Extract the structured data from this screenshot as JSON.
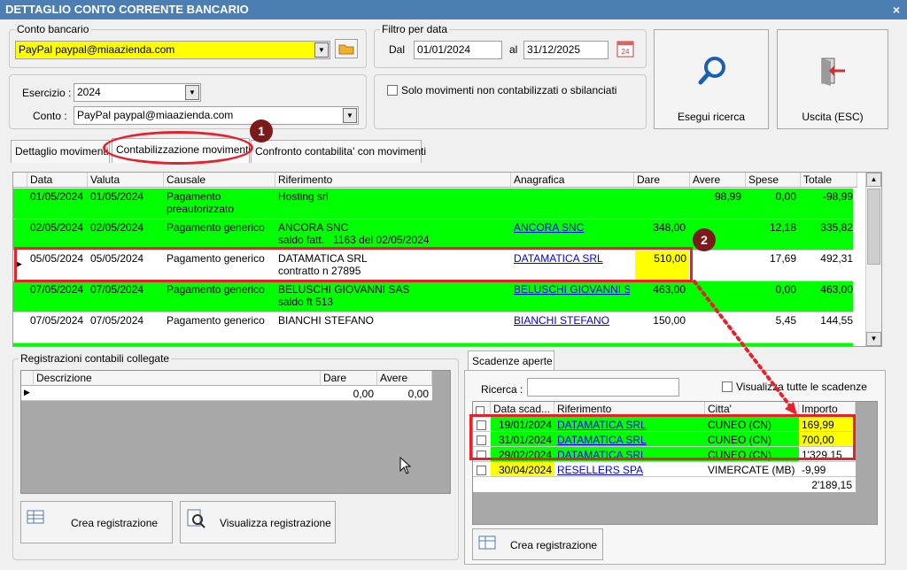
{
  "window": {
    "title": "DETTAGLIO CONTO CORRENTE BANCARIO",
    "close_glyph": "×"
  },
  "conto_bancario": {
    "label": "Conto bancario",
    "value": "PayPal paypal@miaazienda.com"
  },
  "filtro": {
    "label": "Filtro per data",
    "dal_label": "Dal",
    "dal_value": "01/01/2024",
    "al_label": "al",
    "al_value": "31/12/2025",
    "calendar_text": "24"
  },
  "esercizio": {
    "label": "Esercizio :",
    "value": "2024"
  },
  "conto": {
    "label": "Conto :",
    "value": "PayPal paypal@miaazienda.com"
  },
  "solo_movimenti": {
    "label": "Solo movimenti non contabilizzati o sbilanciati"
  },
  "buttons": {
    "esegui": "Esegui ricerca",
    "uscita": "Uscita (ESC)"
  },
  "tabs": [
    {
      "label": "Dettaglio movimenti"
    },
    {
      "label": "Contabilizzazione movimenti"
    },
    {
      "label": "Confronto contabilita' con movimenti"
    }
  ],
  "badges": {
    "one": "1",
    "two": "2"
  },
  "main_grid": {
    "headers": [
      "Data",
      "Valuta",
      "Causale",
      "Riferimento",
      "Anagrafica",
      "Dare",
      "Avere",
      "Spese",
      "Totale"
    ],
    "rows": [
      {
        "data": "01/05/2024",
        "valuta": "01/05/2024",
        "causale": "Pagamento\npreautorizzato",
        "riferimento": "Hosting srl",
        "anagrafica": "",
        "dare": "",
        "avere": "98,99",
        "spese": "0,00",
        "totale": "-98,99",
        "color": "green"
      },
      {
        "data": "02/05/2024",
        "valuta": "02/05/2024",
        "causale": "Pagamento generico",
        "riferimento": "ANCORA SNC\nsaldo fatt.   1163 del 02/05/2024",
        "anagrafica": "ANCORA SNC",
        "dare": "348,00",
        "avere": "",
        "spese": "12,18",
        "totale": "335,82",
        "color": "green"
      },
      {
        "data": "05/05/2024",
        "valuta": "05/05/2024",
        "causale": "Pagamento generico",
        "riferimento": "DATAMATICA SRL\ncontratto n 27895",
        "anagrafica": "DATAMATICA SRL",
        "dare": "510,00",
        "avere": "",
        "spese": "17,69",
        "totale": "492,31",
        "color": "white"
      },
      {
        "data": "07/05/2024",
        "valuta": "07/05/2024",
        "causale": "Pagamento generico",
        "riferimento": "BELUSCHI GIOVANNI SAS\nsaldo ft 513",
        "anagrafica": "BELUSCHI GIOVANNI SAS",
        "dare": "463,00",
        "avere": "",
        "spese": "0,00",
        "totale": "463,00",
        "color": "green"
      },
      {
        "data": "07/05/2024",
        "valuta": "07/05/2024",
        "causale": "Pagamento generico",
        "riferimento": "BIANCHI STEFANO",
        "anagrafica": "BIANCHI STEFANO",
        "dare": "150,00",
        "avere": "",
        "spese": "5,45",
        "totale": "144,55",
        "color": "white"
      }
    ]
  },
  "registrazioni": {
    "label": "Registrazioni contabili collegate",
    "headers": [
      "Descrizione",
      "Dare",
      "Avere"
    ],
    "row": {
      "dare": "0,00",
      "avere": "0,00"
    },
    "crea": "Crea registrazione",
    "visualizza": "Visualizza registrazione"
  },
  "scadenze": {
    "tab": "Scadenze aperte",
    "ricerca_label": "Ricerca :",
    "visualizza_tutte": "Visualizza tutte le scadenze",
    "headers": [
      "Data scad...",
      "Riferimento",
      "Citta'",
      "Importo"
    ],
    "rows": [
      {
        "data": "19/01/2024",
        "riferimento": "DATAMATICA SRL",
        "citta": "CUNEO (CN)",
        "importo": "169,99",
        "color": "green",
        "importo_color": "yellow"
      },
      {
        "data": "31/01/2024",
        "riferimento": "DATAMATICA SRL",
        "citta": "CUNEO (CN)",
        "importo": "700,00",
        "color": "green",
        "importo_color": "yellow"
      },
      {
        "data": "29/02/2024",
        "riferimento": "DATAMATICA SRL",
        "citta": "CUNEO (CN)",
        "importo": "1'329,15",
        "color": "green",
        "importo_color": "white"
      },
      {
        "data": "30/04/2024",
        "riferimento": "RESELLERS SPA",
        "citta": "VIMERCATE (MB)",
        "importo": "-9,99",
        "color": "yellow",
        "importo_color": "white"
      }
    ],
    "total": "2'189,15",
    "crea": "Crea registrazione"
  },
  "colors": {
    "green": "#00ff00",
    "yellow": "#ffff00",
    "red": "#e8202a",
    "title": "#4b7fb3"
  }
}
